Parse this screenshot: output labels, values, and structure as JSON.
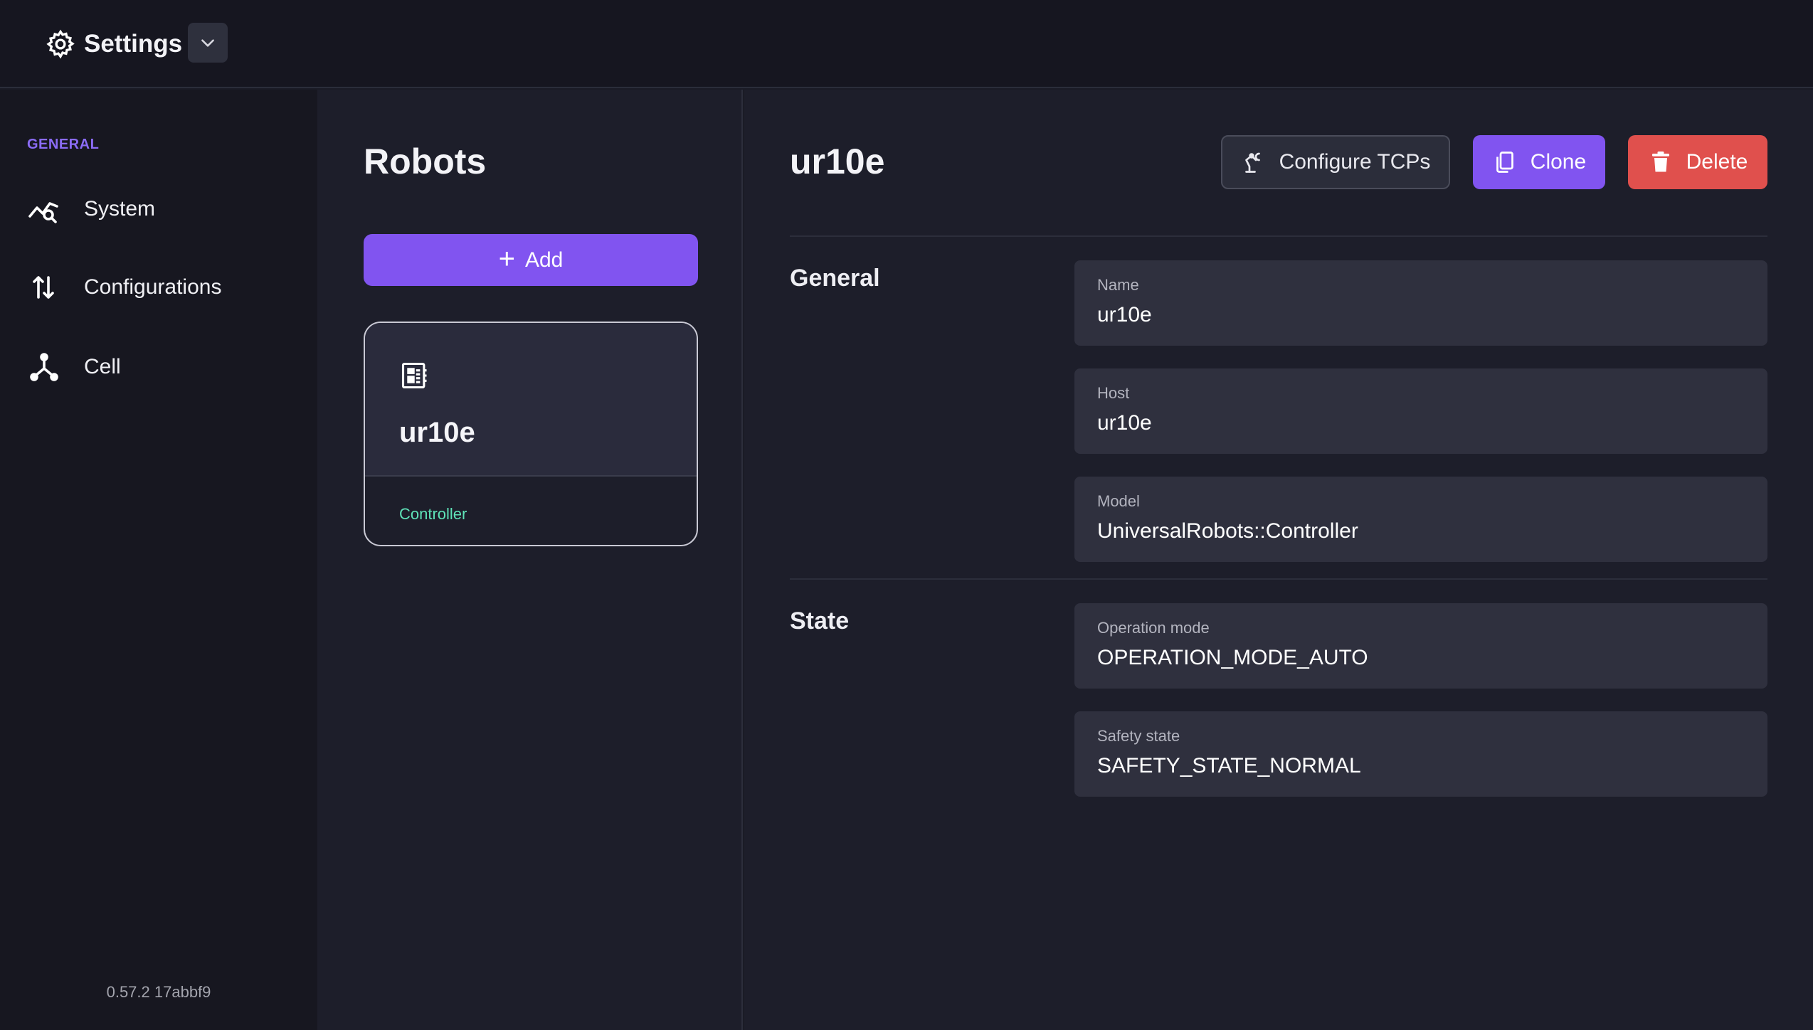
{
  "header": {
    "title": "Settings",
    "dropdown_icon": "chevron-down-icon"
  },
  "nav": {
    "section_label": "GENERAL",
    "items": [
      {
        "label": "System",
        "icon": "chart-search-icon"
      },
      {
        "label": "Configurations",
        "icon": "sort-arrows-icon"
      },
      {
        "label": "Cell",
        "icon": "cell-network-icon"
      }
    ],
    "version": "0.57.2 17abbf9"
  },
  "robots": {
    "title": "Robots",
    "add_label": "Add",
    "cards": [
      {
        "name": "ur10e",
        "type": "Controller",
        "icon": "controller-chip-icon"
      }
    ]
  },
  "detail": {
    "title": "ur10e",
    "actions": {
      "configure_tcps": "Configure TCPs",
      "clone": "Clone",
      "delete": "Delete"
    },
    "general": {
      "label": "General",
      "fields": [
        {
          "label": "Name",
          "value": "ur10e"
        },
        {
          "label": "Host",
          "value": "ur10e"
        },
        {
          "label": "Model",
          "value": "UniversalRobots::Controller"
        }
      ]
    },
    "state": {
      "label": "State",
      "fields": [
        {
          "label": "Operation mode",
          "value": "OPERATION_MODE_AUTO"
        },
        {
          "label": "Safety state",
          "value": "SAFETY_STATE_NORMAL"
        }
      ]
    }
  },
  "colors": {
    "accent": "#8154f0",
    "danger": "#e0504d",
    "success_text": "#5fe3b8",
    "background": "#1a1b26"
  }
}
